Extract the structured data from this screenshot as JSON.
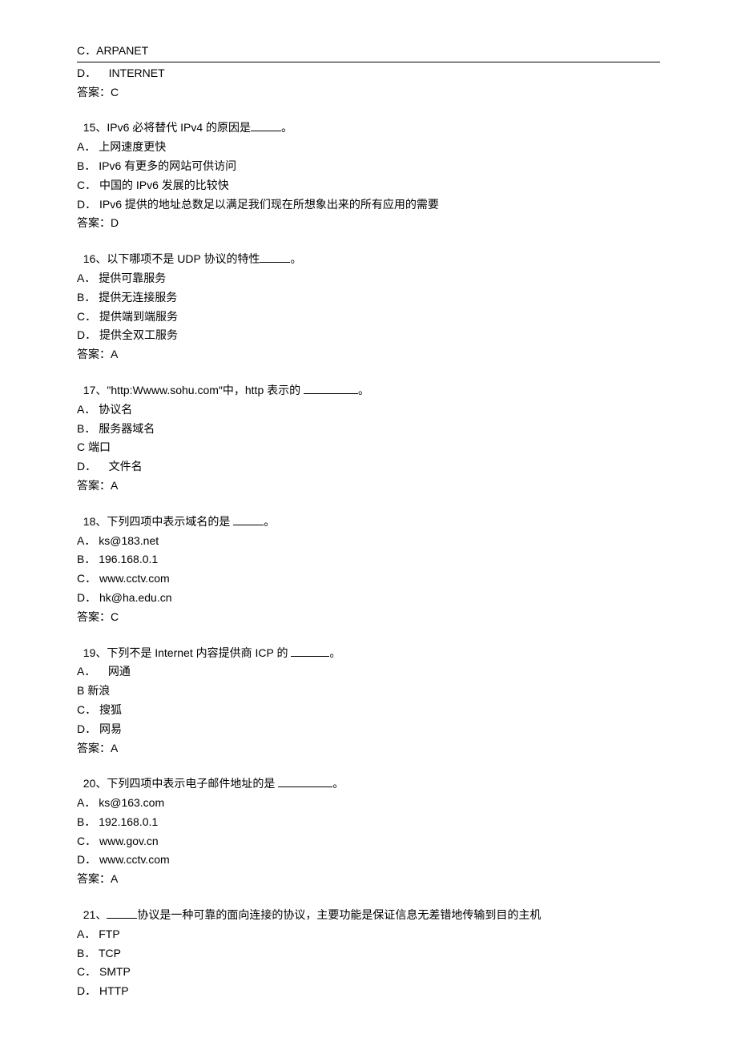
{
  "pre": {
    "optC": "C．ARPANET",
    "optD": "D．    INTERNET",
    "answer": "答案：C"
  },
  "q15": {
    "stem_a": "15、IPv6 必将替代 IPv4 的原因是",
    "stem_b": "。",
    "A": "A． 上网速度更快",
    "B": "B． IPv6 有更多的网站可供访问",
    "C": "C． 中国的 IPv6 发展的比较快",
    "D": "D． IPv6 提供的地址总数足以满足我们现在所想象出来的所有应用的需要",
    "answer": "答案：D"
  },
  "q16": {
    "stem_a": "16、以下哪项不是 UDP 协议的特性",
    "stem_b": "。",
    "A": "A． 提供可靠服务",
    "B": "B． 提供无连接服务",
    "C": "C． 提供端到端服务",
    "D": "D． 提供全双工服务",
    "answer": "答案：A"
  },
  "q17": {
    "stem_a": "17、\"http:Wwww.sohu.com″中，http 表示的 ",
    "stem_b": "。",
    "A": "A． 协议名",
    "B": "B． 服务器域名",
    "C": "C 端口",
    "D": "D．    文件名",
    "answer": "答案：A"
  },
  "q18": {
    "stem_a": "18、下列四项中表示域名的是 ",
    "stem_b": "。",
    "A": "A． ks@183.net",
    "B": "B． 196.168.0.1",
    "C": "C． www.cctv.com",
    "D": "D． hk@ha.edu.cn",
    "answer": "答案：C"
  },
  "q19": {
    "stem_a": "19、下列不是 Internet 内容提供商 ICP 的 ",
    "stem_b": "。",
    "A": "A．    网通",
    "B": "B 新浪",
    "C": "C． 搜狐",
    "D": "D． 网易",
    "answer": "答案：A"
  },
  "q20": {
    "stem_a": "20、下列四项中表示电子邮件地址的是 ",
    "stem_b": "。",
    "A": "A． ks@163.com",
    "B": "B． 192.168.0.1",
    "C": "C． www.gov.cn",
    "D": "D． www.cctv.com",
    "answer": "答案：A"
  },
  "q21": {
    "stem_a": "21、",
    "stem_b": "协议是一种可靠的面向连接的协议，主要功能是保证信息无差错地传输到目的主机",
    "A": "A． FTP",
    "B": "B． TCP",
    "C": "C． SMTP",
    "D": "D． HTTP"
  }
}
